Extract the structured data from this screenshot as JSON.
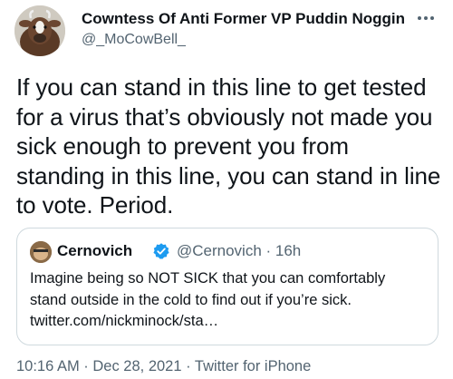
{
  "author": {
    "display_name": "Cowntess Of Anti Former VP Puddin Noggin",
    "handle": "@_MoCowBell_",
    "avatar_icon": "cow-avatar-icon"
  },
  "more_icon": "more-horizontal-icon",
  "tweet": {
    "text": "If you can stand in this line to get tested for a virus that’s obviously not made you sick enough to prevent you from standing in this line, you can stand in line to vote. Period."
  },
  "quoted": {
    "name": "Cernovich",
    "verified_icon": "verified-badge-icon",
    "handle_time": "@Cernovich · 16h",
    "text_lines": [
      "Imagine being so NOT SICK that you can comfortably",
      "stand outside in the cold to find out if you’re sick.",
      "twitter.com/nickminock/sta…"
    ]
  },
  "footer": {
    "timestamp": "10:16 AM · Dec 28, 2021 · Twitter for iPhone"
  },
  "colors": {
    "text": "#0f1419",
    "secondary": "#536471",
    "border": "#cfd9de",
    "verified": "#1d9bf0"
  }
}
